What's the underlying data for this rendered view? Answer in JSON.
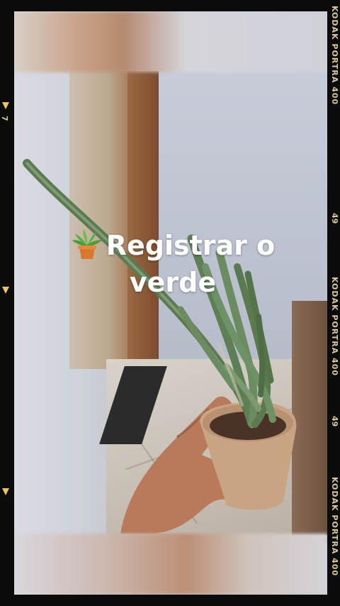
{
  "title": {
    "line1": "Registrar o",
    "line2": "verde",
    "emoji_name": "potted-plant-icon"
  },
  "film_strip": {
    "brand_label": "KODAK PORTRA 400",
    "frame_number": "49",
    "frame_left": "7",
    "accent_color": "#e9c46a"
  }
}
